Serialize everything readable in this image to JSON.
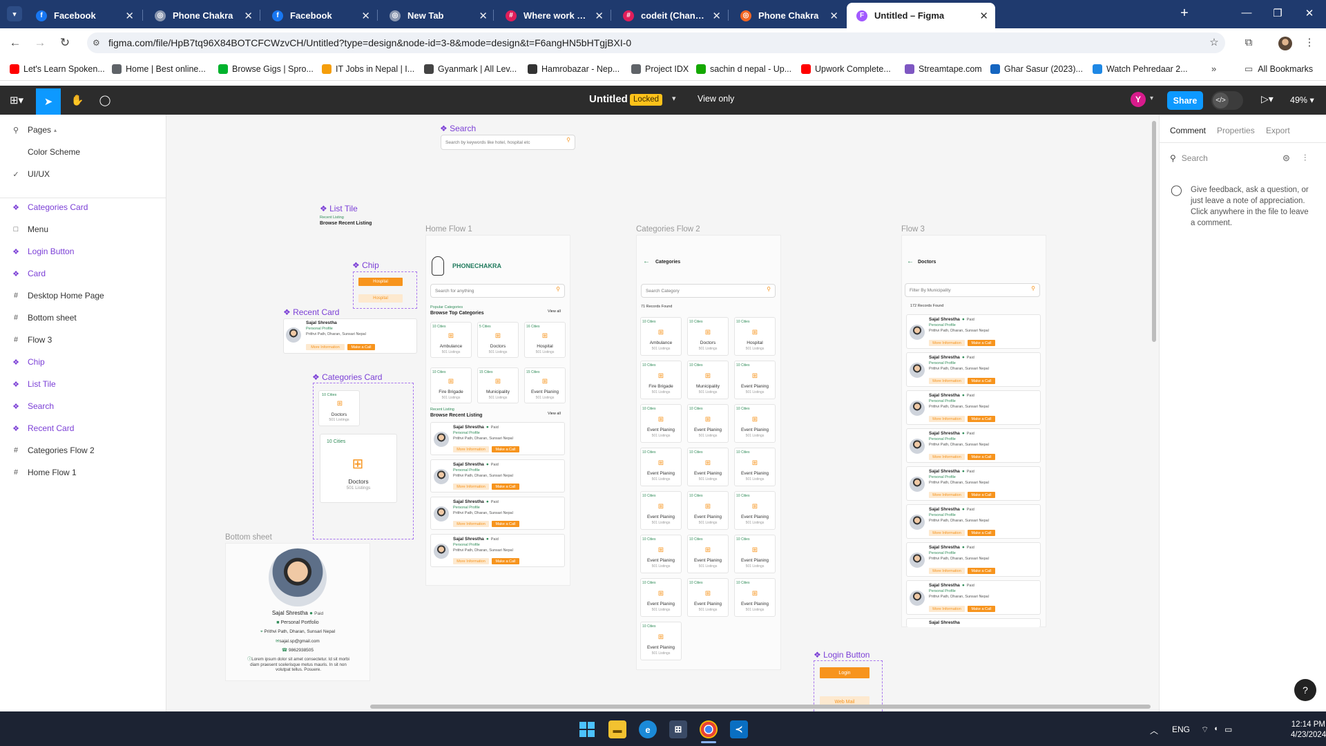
{
  "browser": {
    "tabs": [
      {
        "title": "Facebook",
        "icon": "facebook-icon",
        "color": "#1877f2",
        "glyph": "f"
      },
      {
        "title": "Phone Chakra",
        "icon": "globe-icon",
        "color": "#8a97b0",
        "glyph": "◎"
      },
      {
        "title": "Facebook",
        "icon": "facebook-icon",
        "color": "#1877f2",
        "glyph": "f"
      },
      {
        "title": "New Tab",
        "icon": "chrome-icon",
        "color": "#8a97b0",
        "glyph": "◎"
      },
      {
        "title": "Where work happens | Sl",
        "icon": "slack-icon",
        "color": "#e01e5a",
        "glyph": "#"
      },
      {
        "title": "codeit (Channel) - CODE",
        "icon": "slack-icon",
        "color": "#e01e5a",
        "glyph": "#"
      },
      {
        "title": "Phone Chakra",
        "icon": "phonechakra-icon",
        "color": "#f26522",
        "glyph": "◎"
      },
      {
        "title": "Untitled – Figma",
        "icon": "figma-icon",
        "color": "#a259ff",
        "glyph": "F"
      }
    ],
    "url": "figma.com/file/HpB7tq96X84BOTCFCWzvCH/Untitled?type=design&node-id=3-8&mode=design&t=F6angHN5bHTgjBXI-0",
    "bookmarks": [
      {
        "label": "Let's Learn Spoken...",
        "color": "#ff0000"
      },
      {
        "label": "Home | Best online...",
        "color": "#5f6368"
      },
      {
        "label": "Browse Gigs | Spro...",
        "color": "#00b22d"
      },
      {
        "label": "IT Jobs in Nepal | I...",
        "color": "#f59e0b"
      },
      {
        "label": "Gyanmark | All Lev...",
        "color": "#444444"
      },
      {
        "label": "Hamrobazar - Nep...",
        "color": "#333333"
      },
      {
        "label": "Project IDX",
        "color": "#5f6368"
      },
      {
        "label": "sachin d nepal - Up...",
        "color": "#14a800"
      },
      {
        "label": "Upwork Complete...",
        "color": "#ff0000"
      },
      {
        "label": "Streamtape.com",
        "color": "#7e57c2"
      },
      {
        "label": "Ghar Sasur (2023)...",
        "color": "#1565c0"
      },
      {
        "label": "Watch Pehredaar 2...",
        "color": "#1e88e5"
      }
    ],
    "all_bookmarks": "All Bookmarks"
  },
  "figma": {
    "file_title": "Untitled",
    "locked_badge": "Locked",
    "view_only": "View only",
    "user_initial": "Y",
    "share": "Share",
    "zoom": "49%"
  },
  "left_panel": {
    "pages_title": "Pages",
    "pages": [
      "Color Scheme",
      "UI/UX"
    ],
    "current_page": "UI/UX",
    "layers": [
      {
        "name": "Categories Card",
        "type": "component"
      },
      {
        "name": "Menu",
        "type": "frame-box"
      },
      {
        "name": "Login Button",
        "type": "component"
      },
      {
        "name": "Card",
        "type": "component"
      },
      {
        "name": "Desktop Home Page",
        "type": "frame"
      },
      {
        "name": "Bottom sheet",
        "type": "frame"
      },
      {
        "name": "Flow 3",
        "type": "frame"
      },
      {
        "name": "Chip",
        "type": "component"
      },
      {
        "name": "List Tile",
        "type": "component"
      },
      {
        "name": "Search",
        "type": "component"
      },
      {
        "name": "Recent Card",
        "type": "component"
      },
      {
        "name": "Categories Flow 2",
        "type": "frame"
      },
      {
        "name": "Home Flow 1",
        "type": "frame"
      }
    ]
  },
  "canvas": {
    "search_comp": {
      "label": "Search",
      "placeholder": "Search by keywords like hotel, hospital etc"
    },
    "list_tile": {
      "label": "List Tile",
      "sub": "Recent Listing",
      "title": "Browse Recent Listing"
    },
    "chip": {
      "label": "Chip",
      "a": "Hospital",
      "b": "Hospital"
    },
    "recent_card": {
      "label": "Recent Card"
    },
    "categories_card": {
      "label": "Categories Card",
      "small_badge": "10 Cities",
      "small_name": "Doctors",
      "small_sub": "501 Listings",
      "big_badge": "10 Cities",
      "big_name": "Doctors",
      "big_sub": "501 Listings"
    },
    "bottom_sheet": {
      "label": "Bottom sheet",
      "name": "Sajal Shrestha",
      "paid": "Paid",
      "portfolio": "Personal Portfolio",
      "address": "Prithvi Path, Dharan, Sunsari Nepal",
      "email": "sajal.sp@gmail.com",
      "phone": "9862938505",
      "about": "Lorem ipsum dolor sit amet consectetur. Id sit morbi diam praesent scelerisque metus mauris. In sit non volutpat tellus. Posuere."
    },
    "person": {
      "name": "Sajal Shrestha",
      "paid": "Paid",
      "portfolio": "Personal Profile",
      "address": "Prithvi Path, Dharan, Sunsari Nepal",
      "more": "More Information",
      "call": "Make a Call"
    },
    "home_flow": {
      "label": "Home Flow 1",
      "brand": "PHONECHAKRA",
      "search": "Search for anything",
      "popular_sub": "Popular Categories",
      "popular_title": "Browse Top Categories",
      "view_all": "View all",
      "categories": [
        {
          "badge": "10 Cities",
          "name": "Ambulance",
          "sub": "501 Listings"
        },
        {
          "badge": "5 Cities",
          "name": "Doctors",
          "sub": "501 Listings"
        },
        {
          "badge": "16 Cities",
          "name": "Hospital",
          "sub": "501 Listings"
        },
        {
          "badge": "10 Cities",
          "name": "Fire Brigade",
          "sub": "501 Listings"
        },
        {
          "badge": "15 Cities",
          "name": "Municipality",
          "sub": "501 Listings"
        },
        {
          "badge": "15 Cities",
          "name": "Event Planing",
          "sub": "501 Listings"
        }
      ],
      "recent_sub": "Recent Listing",
      "recent_title": "Browse Recent Listing"
    },
    "cat_flow": {
      "label": "Categories Flow 2",
      "title": "Categories",
      "search": "Search Category",
      "records": "71 Records Found",
      "items": [
        "Ambulance",
        "Doctors",
        "Hospital",
        "Fire Brigade",
        "Municipality",
        "Event Planing",
        "Event Planing",
        "Event Planing",
        "Event Planing",
        "Event Planing",
        "Event Planing",
        "Event Planing",
        "Event Planing",
        "Event Planing",
        "Event Planing",
        "Event Planing",
        "Event Planing",
        "Event Planing",
        "Event Planing",
        "Event Planing",
        "Event Planing",
        "Event Planing"
      ],
      "badge": "10 Cities",
      "sub": "501 Listings"
    },
    "flow3": {
      "label": "Flow 3",
      "title": "Doctors",
      "search": "Filter By Municipality",
      "records": "172 Records Found"
    },
    "login_comp": {
      "label": "Login Button",
      "primary": "Login",
      "secondary": "Web Mail"
    }
  },
  "right_panel": {
    "tabs": [
      "Comment",
      "Properties",
      "Export"
    ],
    "active_tab": "Comment",
    "search_placeholder": "Search",
    "hint": "Give feedback, ask a question, or just leave a note of appreciation. Click anywhere in the file to leave a comment."
  },
  "taskbar": {
    "lang": "ENG",
    "time": "12:14 PM",
    "date": "4/23/2024"
  }
}
